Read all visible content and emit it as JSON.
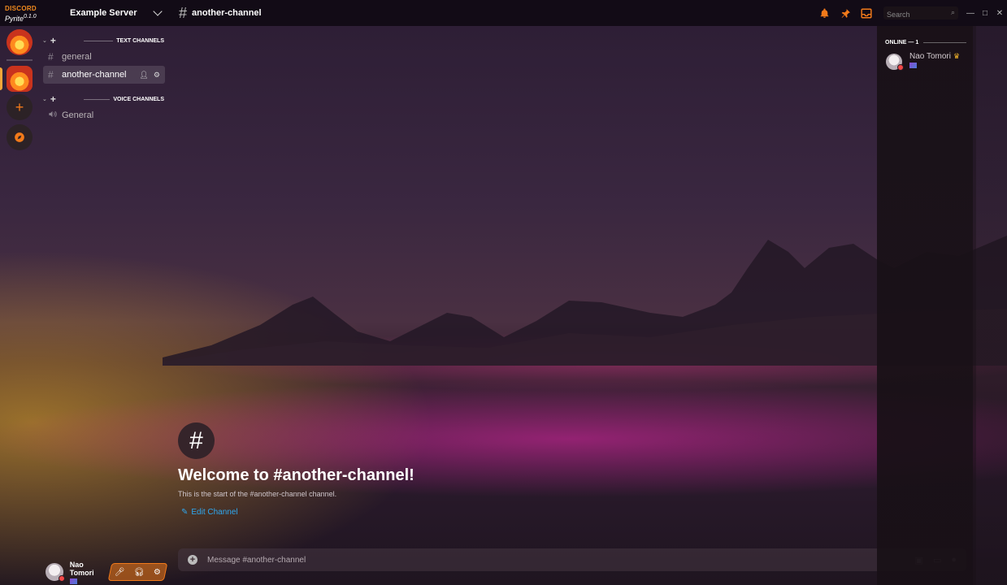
{
  "app": {
    "brand": "DISCORD",
    "theme": "Pyrite",
    "theme_version": "0.1.0"
  },
  "server": {
    "name": "Example Server"
  },
  "header": {
    "channel_name": "another-channel",
    "search_placeholder": "Search",
    "icons": [
      "bell-icon",
      "pin-icon",
      "inbox-icon",
      "search-icon"
    ],
    "window_controls": [
      "minimize-icon",
      "maximize-icon",
      "close-icon"
    ]
  },
  "rail": {
    "items": [
      "home-server",
      "example-server",
      "add-server",
      "explore"
    ]
  },
  "sidebar": {
    "text_category": "TEXT CHANNELS",
    "voice_category": "VOICE CHANNELS",
    "text_channels": [
      {
        "name": "general",
        "active": false
      },
      {
        "name": "another-channel",
        "active": true
      }
    ],
    "voice_channels": [
      {
        "name": "General"
      }
    ]
  },
  "user": {
    "name": "Nao Tomori",
    "status": "dnd"
  },
  "chat": {
    "welcome_title": "Welcome to #another-channel!",
    "welcome_subtitle": "This is the start of the #another-channel channel.",
    "edit_label": "Edit Channel",
    "composer_placeholder": "Message #another-channel"
  },
  "members": {
    "header": "ONLINE — 1",
    "list": [
      {
        "name": "Nao Tomori",
        "owner": true,
        "status": "dnd"
      }
    ]
  },
  "colors": {
    "accent": "#f27a1a",
    "link": "#2fa8f0",
    "dnd": "#f04747"
  }
}
